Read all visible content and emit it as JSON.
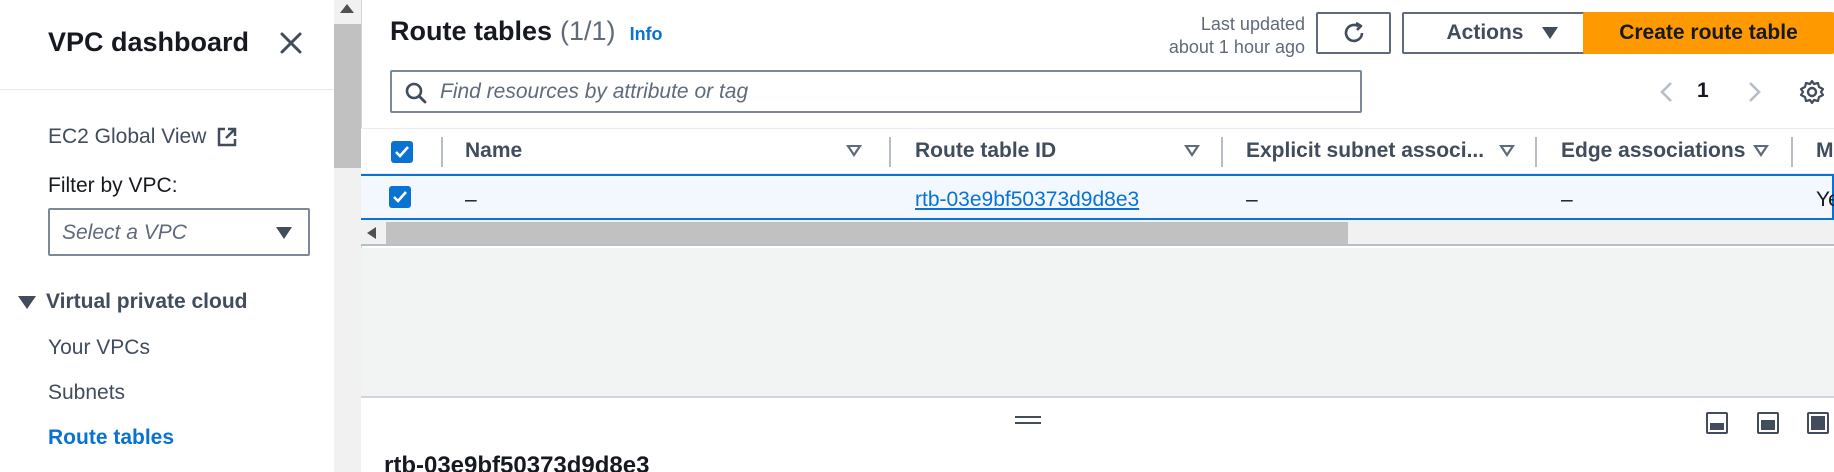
{
  "sidebar": {
    "title": "VPC dashboard",
    "ec2_global_view": "EC2 Global View",
    "filter_label": "Filter by VPC:",
    "filter_placeholder": "Select a VPC",
    "section_title": "Virtual private cloud",
    "items": [
      {
        "label": "Your VPCs",
        "active": false
      },
      {
        "label": "Subnets",
        "active": false
      },
      {
        "label": "Route tables",
        "active": true
      }
    ]
  },
  "header": {
    "title": "Route tables",
    "count": "(1/1)",
    "info": "Info",
    "last_updated_line1": "Last updated",
    "last_updated_line2": "about 1 hour ago",
    "actions_label": "Actions",
    "create_label": "Create route table"
  },
  "search": {
    "placeholder": "Find resources by attribute or tag"
  },
  "pagination": {
    "current_page": "1"
  },
  "table": {
    "columns": [
      "Name",
      "Route table ID",
      "Explicit subnet associ...",
      "Edge associations",
      "M"
    ],
    "rows": [
      {
        "selected": true,
        "name": "–",
        "route_table_id": "rtb-03e9bf50373d9d8e3",
        "explicit_subnet": "–",
        "edge_associations": "–",
        "main": "Ye"
      }
    ]
  },
  "split_panel": {
    "title": "rtb-03e9bf50373d9d8e3"
  },
  "colors": {
    "accent": "#0972d3",
    "primary_button": "#ff9900",
    "selected_row": "#f2f8fd"
  }
}
